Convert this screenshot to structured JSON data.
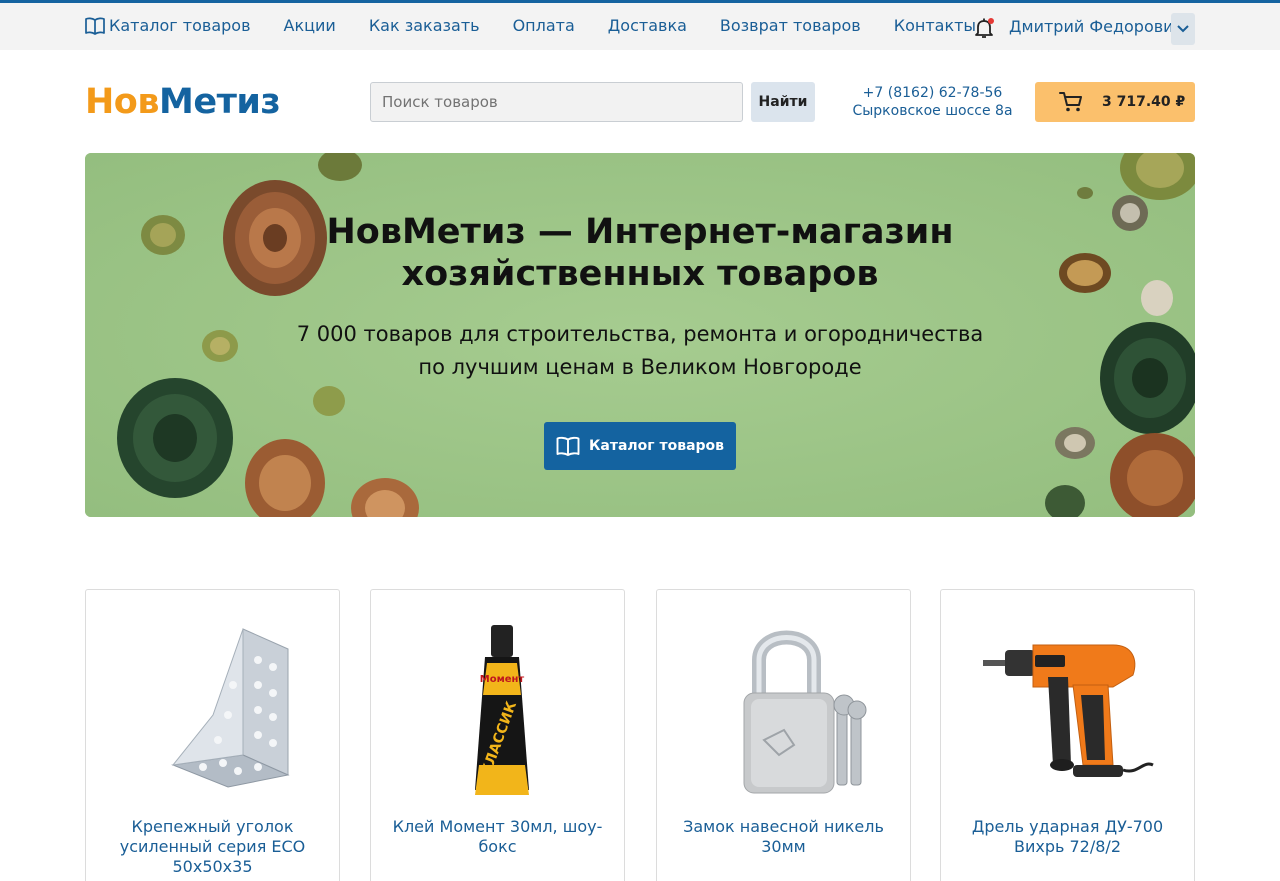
{
  "topnav": {
    "items": [
      {
        "label": "Каталог товаров",
        "icon": "book-icon"
      },
      {
        "label": "Акции"
      },
      {
        "label": "Как заказать"
      },
      {
        "label": "Оплата"
      },
      {
        "label": "Доставка"
      },
      {
        "label": "Возврат товаров"
      },
      {
        "label": "Контакты"
      }
    ],
    "user_name": "Дмитрий Федорович",
    "notification_dot_color": "#e53935"
  },
  "header": {
    "logo_part1": "Нов",
    "logo_part2": "Метиз",
    "search_placeholder": "Поиск товаров",
    "search_button": "Найти",
    "phone": "+7 (8162) 62-78-56",
    "address": "Сырковское шоссе 8а",
    "cart_total": "3 717.40 ₽"
  },
  "banner": {
    "title_line1": "НовМетиз — Интернет-магазин",
    "title_line2": "хозяйственных товаров",
    "subtitle_line1": "7 000 товаров для строительства, ремонта и огородничества",
    "subtitle_line2": "по лучшим ценам в Великом Новгороде",
    "button_label": "Каталог товаров"
  },
  "products": [
    {
      "name": "Крепежный уголок усиленный серия ECO 50x50x35"
    },
    {
      "name": "Клей Момент 30мл, шоу-бокс"
    },
    {
      "name": "Замок навесной никель 30мм"
    },
    {
      "name": "Дрель ударная ДУ-700 Вихрь 72/8/2"
    }
  ],
  "colors": {
    "brand_blue": "#1463a0",
    "brand_orange": "#f39a1a",
    "cart_button": "#fbc06c",
    "banner_green": "#a2c88b"
  }
}
